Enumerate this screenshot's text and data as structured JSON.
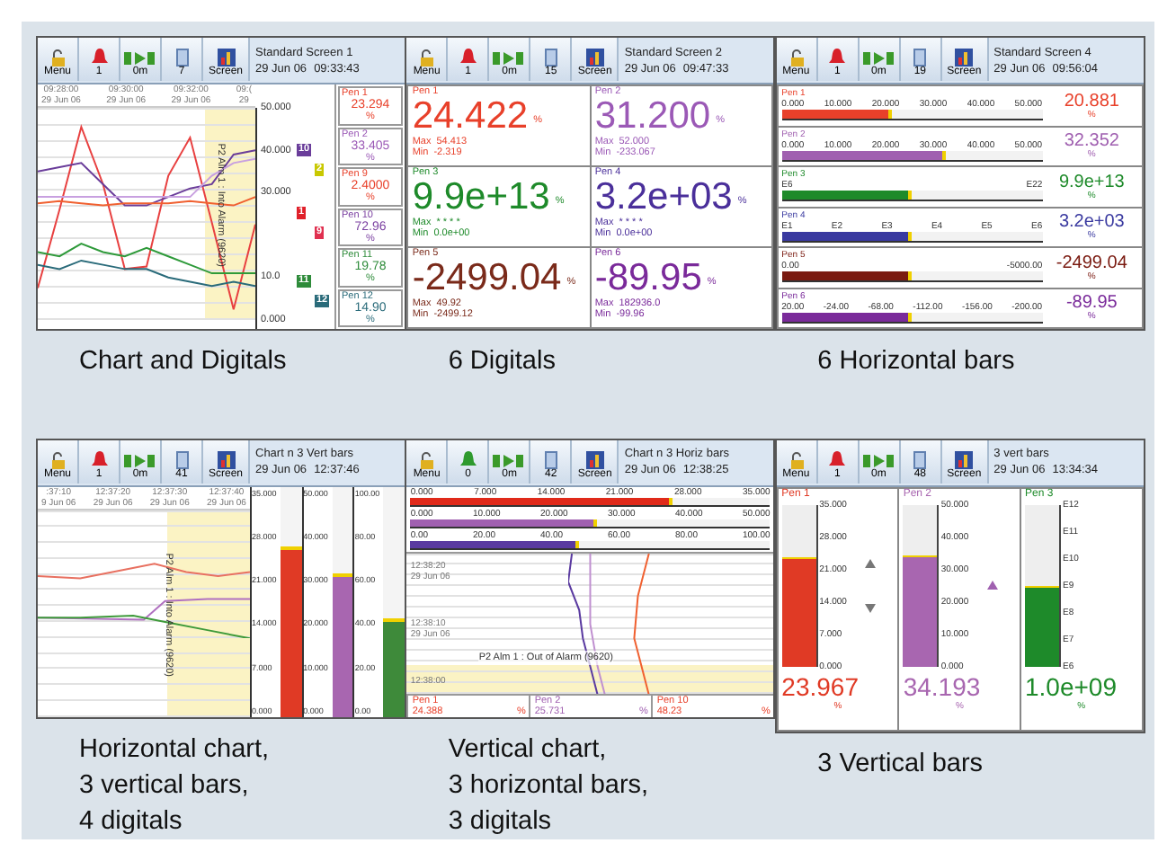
{
  "panels": [
    {
      "kind": "chart_digitals",
      "toolbar": {
        "menu": "Menu",
        "alarm_active": true,
        "alarms": "1",
        "timer": "0m",
        "count": "7",
        "screen": "Screen"
      },
      "title": "Standard Screen 1",
      "date": "29 Jun 06",
      "time": "09:33:43",
      "time_labels": [
        {
          "time": "09:28:00",
          "date": "29 Jun 06"
        },
        {
          "time": "09:30:00",
          "date": "29 Jun 06"
        },
        {
          "time": "09:32:00",
          "date": "29 Jun 06"
        },
        {
          "time": "09:(",
          "date": "29"
        }
      ],
      "alarm_text": "P2 Alm 1 : Into Alarm (9620)",
      "chart_data": {
        "type": "line",
        "grid": true,
        "ylim": [
          0,
          50
        ],
        "yticks": [
          {
            "value": 50,
            "label": "50.000"
          },
          {
            "value": 40,
            "label": "40.000"
          },
          {
            "value": 30,
            "label": "30.000"
          },
          {
            "value": 10,
            "label": "10.0"
          },
          {
            "value": 0,
            "label": "0.000"
          }
        ],
        "series": [
          {
            "color": "#e84040",
            "values": [
              7.5,
              26,
              45.5,
              32,
              12,
              12.6,
              34,
              43,
              23,
              2.5,
              22.5
            ]
          },
          {
            "color": "#6a3d9a",
            "values": [
              35,
              36,
              37,
              32,
              27,
              27,
              29,
              31,
              32,
              39,
              40
            ]
          },
          {
            "color": "#f06030",
            "values": [
              27.5,
              28,
              27.5,
              27,
              27.5,
              27.5,
              27.5,
              28,
              27.5,
              27,
              29
            ]
          },
          {
            "color": "#2e9a3a",
            "values": [
              16,
              15,
              18,
              16,
              15,
              17,
              15,
              13,
              11,
              11,
              11
            ]
          },
          {
            "color": "#2a6b7a",
            "values": [
              13,
              12,
              14,
              13,
              12,
              12,
              10,
              9,
              8,
              9,
              8
            ]
          },
          {
            "color": "#c8a0e0",
            "values": [
              29,
              29,
              29,
              29,
              29,
              29,
              29,
              29,
              34,
              37,
              38
            ]
          }
        ]
      },
      "markers": [
        {
          "label": "10",
          "color": "#6a3d9a"
        },
        {
          "label": "2",
          "color": "#c8c800"
        },
        {
          "label": "1",
          "color": "#e0202a"
        },
        {
          "label": "9",
          "color": "#e03050"
        },
        {
          "label": "11",
          "color": "#2e8b3a"
        },
        {
          "label": "12",
          "color": "#2a6b7a"
        }
      ],
      "pens": [
        {
          "pen": "Pen 1",
          "value": "23.294",
          "unit": "%",
          "color": "#e8402a"
        },
        {
          "pen": "Pen 2",
          "value": "33.405",
          "unit": "%",
          "color": "#9b59b6"
        },
        {
          "pen": "Pen 9",
          "value": "2.4000",
          "unit": "%",
          "color": "#e8402a"
        },
        {
          "pen": "Pen 10",
          "value": "72.96",
          "unit": "%",
          "color": "#7a3fa0"
        },
        {
          "pen": "Pen 11",
          "value": "19.78",
          "unit": "%",
          "color": "#2e8b3a"
        },
        {
          "pen": "Pen 12",
          "value": "14.90",
          "unit": "%",
          "color": "#2a6b7a"
        }
      ],
      "caption": [
        "Chart and Digitals"
      ]
    },
    {
      "kind": "digitals",
      "toolbar": {
        "menu": "Menu",
        "alarm_active": true,
        "alarms": "1",
        "timer": "0m",
        "count": "15",
        "screen": "Screen"
      },
      "title": "Standard Screen 2",
      "date": "29 Jun 06",
      "time": "09:47:33",
      "pens": [
        {
          "pen": "Pen 1",
          "value": "24.422",
          "unit": "%",
          "max_label": "Max",
          "max": "54.413",
          "min_label": "Min",
          "min": "-2.319",
          "color": "#e8402a"
        },
        {
          "pen": "Pen 2",
          "value": "31.200",
          "unit": "%",
          "max_label": "Max",
          "max": "52.000",
          "min_label": "Min",
          "min": "-233.067",
          "color": "#9b59b6"
        },
        {
          "pen": "Pen 3",
          "value": "9.9e+13",
          "unit": "%",
          "max_label": "Max",
          "max": "* * * *",
          "min_label": "Min",
          "min": "0.0e+00",
          "color": "#1e8a2a"
        },
        {
          "pen": "Pen 4",
          "value": "3.2e+03",
          "unit": "%",
          "max_label": "Max",
          "max": "* * * *",
          "min_label": "Min",
          "min": "0.0e+00",
          "color": "#4a2f9a"
        },
        {
          "pen": "Pen 5",
          "value": "-2499.04",
          "unit": "%",
          "max_label": "Max",
          "max": "49.92",
          "min_label": "Min",
          "min": "-2499.12",
          "color": "#7a2a1a"
        },
        {
          "pen": "Pen 6",
          "value": "-89.95",
          "unit": "%",
          "max_label": "Max",
          "max": "182936.0",
          "min_label": "Min",
          "min": "-99.96",
          "color": "#7a2a9a"
        }
      ],
      "caption": [
        "6 Digitals"
      ]
    },
    {
      "kind": "hbars",
      "toolbar": {
        "menu": "Menu",
        "alarm_active": true,
        "alarms": "1",
        "timer": "0m",
        "count": "19",
        "screen": "Screen"
      },
      "title": "Standard Screen 4",
      "date": "29 Jun 06",
      "time": "09:56:04",
      "pens": [
        {
          "pen": "Pen 1",
          "scale": [
            "0.000",
            "10.000",
            "20.000",
            "30.000",
            "40.000",
            "50.000"
          ],
          "level": 0.42,
          "value": "20.881",
          "unit": "%",
          "color": "#e8402a"
        },
        {
          "pen": "Pen 2",
          "scale": [
            "0.000",
            "10.000",
            "20.000",
            "30.000",
            "40.000",
            "50.000"
          ],
          "level": 0.63,
          "value": "32.352",
          "unit": "%",
          "color": "#a060b0"
        },
        {
          "pen": "Pen 3",
          "scale": [
            "E6",
            "E22"
          ],
          "level": 0.5,
          "value": "9.9e+13",
          "unit": "%",
          "color": "#1e8a2a"
        },
        {
          "pen": "Pen 4",
          "scale": [
            "E1",
            "E2",
            "E3",
            "E4",
            "E5",
            "E6"
          ],
          "level": 0.5,
          "value": "3.2e+03",
          "unit": "%",
          "color": "#3a3aa0"
        },
        {
          "pen": "Pen 5",
          "scale": [
            "0.00",
            "-5000.00"
          ],
          "level": 0.5,
          "value": "-2499.04",
          "unit": "%",
          "color": "#7a1a10"
        },
        {
          "pen": "Pen 6",
          "scale": [
            "20.00",
            "-24.00",
            "-68.00",
            "-112.00",
            "-156.00",
            "-200.00"
          ],
          "level": 0.5,
          "value": "-89.95",
          "unit": "%",
          "color": "#7a2a9a"
        }
      ],
      "caption": [
        "6 Horizontal bars"
      ]
    },
    {
      "kind": "chart_vbars",
      "toolbar": {
        "menu": "Menu",
        "alarm_active": true,
        "alarms": "1",
        "timer": "0m",
        "count": "41",
        "screen": "Screen"
      },
      "title": "Chart n 3 Vert bars",
      "date": "29 Jun 06",
      "time": "12:37:46",
      "time_labels": [
        {
          "time": ":37:10",
          "date": "9 Jun 06"
        },
        {
          "time": "12:37:20",
          "date": "29 Jun 06"
        },
        {
          "time": "12:37:30",
          "date": "29 Jun 06"
        },
        {
          "time": "12:37:40",
          "date": "29 Jun 06"
        }
      ],
      "alarm_text": "P2 Alm 1 : Into Alarm (9620)",
      "bars": [
        {
          "scale": [
            "35.000",
            "28.000",
            "21.000",
            "14.000",
            "7.000",
            "0.000"
          ],
          "level": 0.74,
          "color": "#e03a25"
        },
        {
          "scale": [
            "50.000",
            "40.000",
            "30.000",
            "20.000",
            "10.000",
            "0.000"
          ],
          "level": 0.62,
          "color": "#a866b0"
        },
        {
          "scale": [
            "100.00",
            "80.00",
            "60.00",
            "40.00",
            "20.00",
            "0.00"
          ],
          "level": 0.43,
          "color": "#3e8a3a"
        }
      ],
      "caption": [
        "Horizontal chart,",
        "3 vertical bars,",
        "4 digitals"
      ]
    },
    {
      "kind": "vchart_hbars",
      "toolbar": {
        "menu": "Menu",
        "alarm_active": false,
        "alarms": "0",
        "timer": "0m",
        "count": "42",
        "screen": "Screen"
      },
      "title": "Chart n 3 Horiz bars",
      "date": "29 Jun 06",
      "time": "12:38:25",
      "bars": [
        {
          "scale": [
            "0.000",
            "7.000",
            "14.000",
            "21.000",
            "28.000",
            "35.000"
          ],
          "level": 0.73,
          "color": "#e02a1a"
        },
        {
          "scale": [
            "0.000",
            "10.000",
            "20.000",
            "30.000",
            "40.000",
            "50.000"
          ],
          "level": 0.52,
          "color": "#a060b0"
        },
        {
          "scale": [
            "0.00",
            "20.00",
            "40.00",
            "60.00",
            "80.00",
            "100.00"
          ],
          "level": 0.47,
          "color": "#5a3aa0"
        }
      ],
      "time_labels": [
        {
          "time": "12:38:20",
          "date": "29 Jun 06"
        },
        {
          "time": "12:38:10",
          "date": "29 Jun 06"
        },
        {
          "time": "12:38:00"
        }
      ],
      "alarm_text": "P2 Alm 1 : Out of Alarm (9620)",
      "pens": [
        {
          "pen": "Pen 1",
          "value": "24.388",
          "unit": "%",
          "color": "#e8402a"
        },
        {
          "pen": "Pen 2",
          "value": "25.731",
          "unit": "%",
          "color": "#a060b0"
        },
        {
          "pen": "Pen 10",
          "value": "48.23",
          "unit": "%",
          "color": "#e8402a"
        }
      ],
      "caption": [
        "Vertical chart,",
        "3 horizontal bars,",
        "3 digitals"
      ]
    },
    {
      "kind": "vbars",
      "toolbar": {
        "menu": "Menu",
        "alarm_active": true,
        "alarms": "1",
        "timer": "0m",
        "count": "48",
        "screen": "Screen"
      },
      "title": "3 vert bars",
      "date": "29 Jun 06",
      "time": "13:34:34",
      "pens": [
        {
          "pen": "Pen 1",
          "scale": [
            "35.000",
            "28.000",
            "21.000",
            "14.000",
            "7.000",
            "0.000"
          ],
          "level": 0.67,
          "value": "23.967",
          "unit": "%",
          "color": "#e03a25"
        },
        {
          "pen": "Pen 2",
          "scale": [
            "50.000",
            "40.000",
            "30.000",
            "20.000",
            "10.000",
            "0.000"
          ],
          "level": 0.68,
          "value": "34.193",
          "unit": "%",
          "color": "#a866b0"
        },
        {
          "pen": "Pen 3",
          "scale": [
            "E12",
            "E11",
            "E10",
            "E9",
            "E8",
            "E7",
            "E6"
          ],
          "level": 0.5,
          "value": "1.0e+09",
          "unit": "%",
          "color": "#1e8a2a"
        }
      ],
      "caption": [
        "3 Vertical bars"
      ]
    }
  ]
}
